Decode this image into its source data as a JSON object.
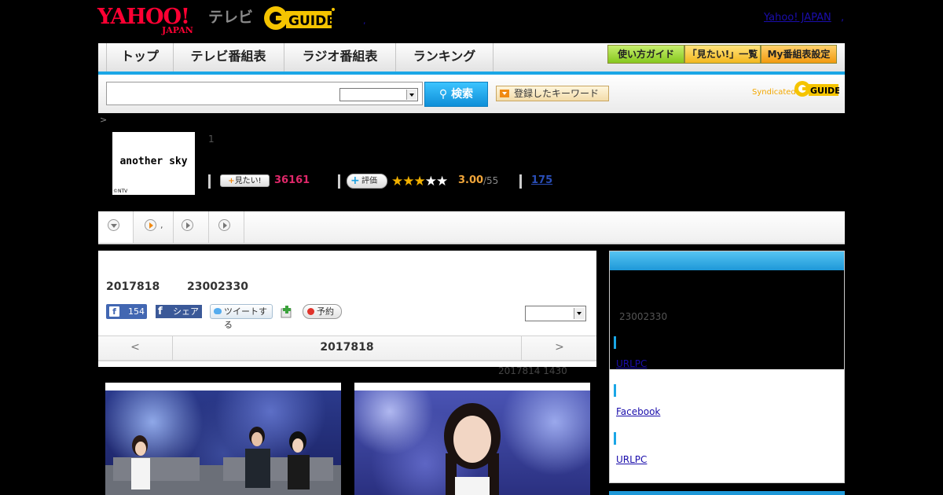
{
  "header": {
    "yahoo_logo": "YAHOO!",
    "yahoo_logo_sub": "JAPAN",
    "tv_label": "テレビ",
    "gguide_logo": "G-GUIDE",
    "yahoo_japan_link": "Yahoo! JAPAN",
    "comma_a": ",",
    "comma_b": ","
  },
  "nav": {
    "tabs": [
      "トップ",
      "テレビ番組表",
      "ラジオ番組表",
      "ランキング"
    ],
    "guide_button": "使い方ガイド",
    "mitai_list_button": "「見たい!」一覧",
    "my_schedule_button": "My番組表設定"
  },
  "search": {
    "placeholder": "",
    "select_value": "",
    "search_button": "検索",
    "keyword_button": "登録したキーワード",
    "syndicated_label": "Syndicated",
    "syndicated_logo": "G-GUIDE"
  },
  "breadcrumb": {
    "separator": ">"
  },
  "program": {
    "thumbnail_title": "another sky",
    "thumbnail_credit": "©NTV",
    "episode_number": "1",
    "mitai_label": "見たい!",
    "mitai_count": "36161",
    "rating_label": "評価",
    "rating_value": "3.00",
    "rating_max": "/55",
    "rating_stars": 3,
    "review_count": "175"
  },
  "tabs": {
    "second_tab_text": ","
  },
  "main": {
    "air_date": "2017818",
    "air_time": "23002330",
    "fb_like_count": "154",
    "fb_share_label": "シェア",
    "tweet_label": "ツイートする",
    "reserve_label": "予約",
    "date_prev": "<",
    "date_current": "2017818",
    "date_next": ">",
    "update_stamp": "2017814  1430"
  },
  "sidebar": {
    "time": "23002330",
    "links": [
      "URLPC",
      "Facebook",
      "URLPC"
    ]
  },
  "colors": {
    "accent_blue": "#1aa6e6",
    "mitai_pink": "#e0286a",
    "rating_orange": "#f0a53a"
  }
}
